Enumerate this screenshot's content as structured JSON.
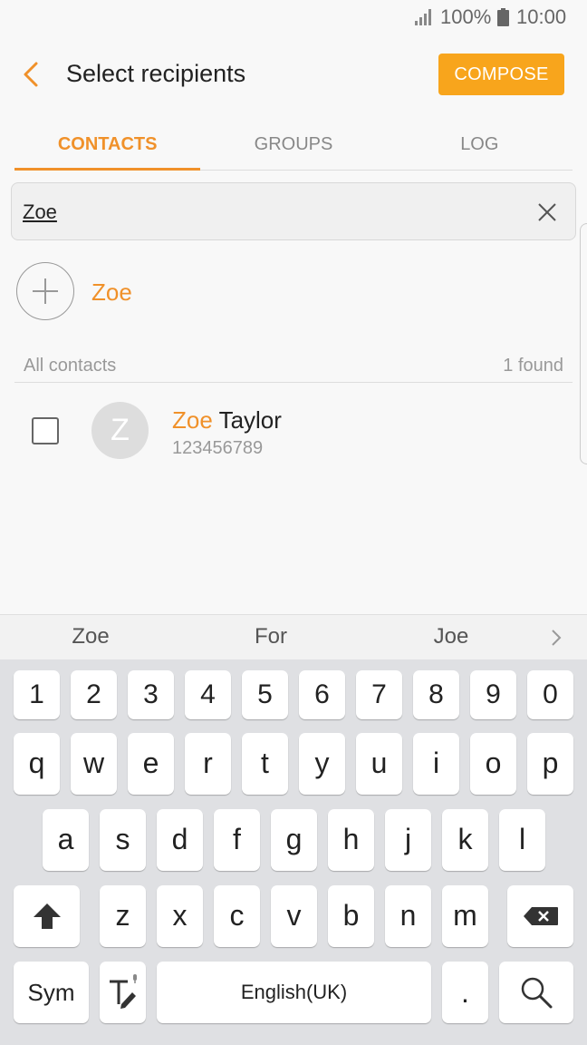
{
  "status_bar": {
    "battery": "100%",
    "time": "10:00"
  },
  "header": {
    "title": "Select recipients",
    "compose_label": "COMPOSE"
  },
  "tabs": [
    {
      "label": "CONTACTS",
      "active": true
    },
    {
      "label": "GROUPS",
      "active": false
    },
    {
      "label": "LOG",
      "active": false
    }
  ],
  "search": {
    "value": "Zoe"
  },
  "add_row": {
    "label": "Zoe"
  },
  "section": {
    "label": "All contacts",
    "count": "1 found"
  },
  "contact": {
    "initial": "Z",
    "name_match": "Zoe",
    "name_rest": " Taylor",
    "number": "123456789",
    "checked": false
  },
  "suggestions": [
    "Zoe",
    "For",
    "Joe"
  ],
  "keyboard": {
    "numbers": [
      "1",
      "2",
      "3",
      "4",
      "5",
      "6",
      "7",
      "8",
      "9",
      "0"
    ],
    "row1": [
      "q",
      "w",
      "e",
      "r",
      "t",
      "y",
      "u",
      "i",
      "o",
      "p"
    ],
    "row2": [
      "a",
      "s",
      "d",
      "f",
      "g",
      "h",
      "j",
      "k",
      "l"
    ],
    "row3": [
      "z",
      "x",
      "c",
      "v",
      "b",
      "n",
      "m"
    ],
    "sym_label": "Sym",
    "space_label": "English(UK)",
    "period_label": "."
  },
  "colors": {
    "accent": "#f0912a",
    "compose": "#f8a51c"
  }
}
